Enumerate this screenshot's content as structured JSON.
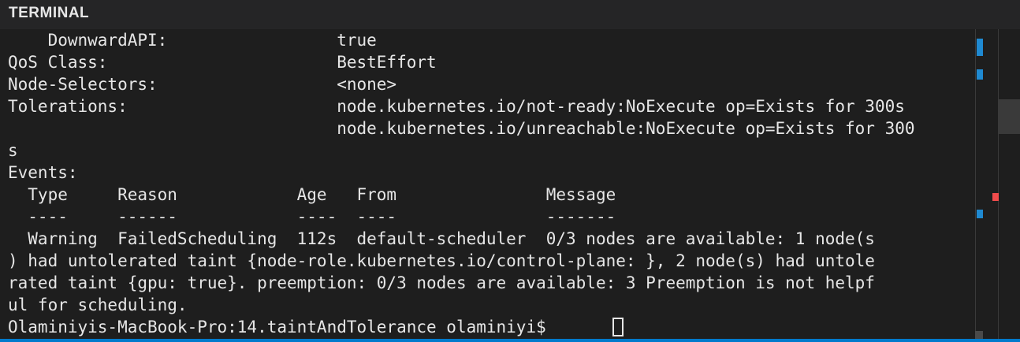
{
  "panel": {
    "title": "TERMINAL"
  },
  "terminal": {
    "lines": [
      "    DownwardAPI:                 true",
      "QoS Class:                       BestEffort",
      "Node-Selectors:                  <none>",
      "Tolerations:                     node.kubernetes.io/not-ready:NoExecute op=Exists for 300s",
      "                                 node.kubernetes.io/unreachable:NoExecute op=Exists for 300",
      "s",
      "Events:",
      "  Type     Reason            Age   From               Message",
      "  ----     ------            ----  ----               -------",
      "  Warning  FailedScheduling  112s  default-scheduler  0/3 nodes are available: 1 node(s",
      ") had untolerated taint {node-role.kubernetes.io/control-plane: }, 2 node(s) had untole",
      "rated taint {gpu: true}. preemption: 0/3 nodes are available: 3 Preemption is not helpf",
      "ul for scheduling.",
      "Olaminiyis-MacBook-Pro:14.taintAndTolerance olaminiyi$ "
    ]
  },
  "colors": {
    "background": "#1e1e1e",
    "header": "#252526",
    "text": "#e6e6e6",
    "accent": "#007acc",
    "marker_blue": "#1f8ad2",
    "marker_red": "#f14c4c"
  }
}
